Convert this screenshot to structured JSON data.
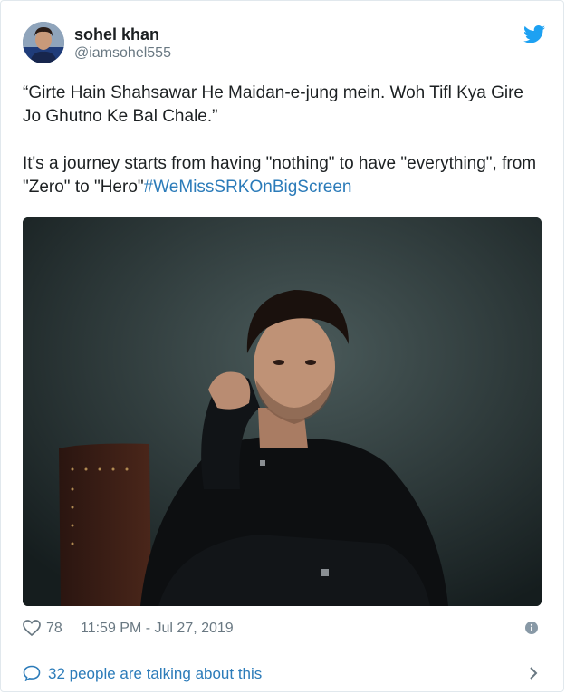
{
  "author": {
    "name": "sohel khan",
    "handle": "@iamsohel555"
  },
  "tweet": {
    "paragraph1": "“Girte Hain Shahsawar He Maidan-e-jung mein. Woh Tifl Kya Gire Jo Ghutno Ke Bal Chale.”",
    "paragraph2": "It's a journey starts from having \"nothing\" to have \"everything\", from \"Zero\" to \"Hero\"",
    "hashtag": "#WeMissSRKOnBigScreen"
  },
  "meta": {
    "likes": "78",
    "timestamp": "11:59 PM - Jul 27, 2019"
  },
  "footer": {
    "talking": "32 people are talking about this"
  },
  "icons": {
    "brand": "twitter-bird-icon",
    "like": "heart-icon",
    "info": "info-icon",
    "reply": "speech-bubble-icon",
    "more": "chevron-right-icon"
  },
  "colors": {
    "link": "#2b7bb9",
    "twitter": "#1da1f2",
    "muted": "#697882",
    "text": "#1c2022"
  }
}
